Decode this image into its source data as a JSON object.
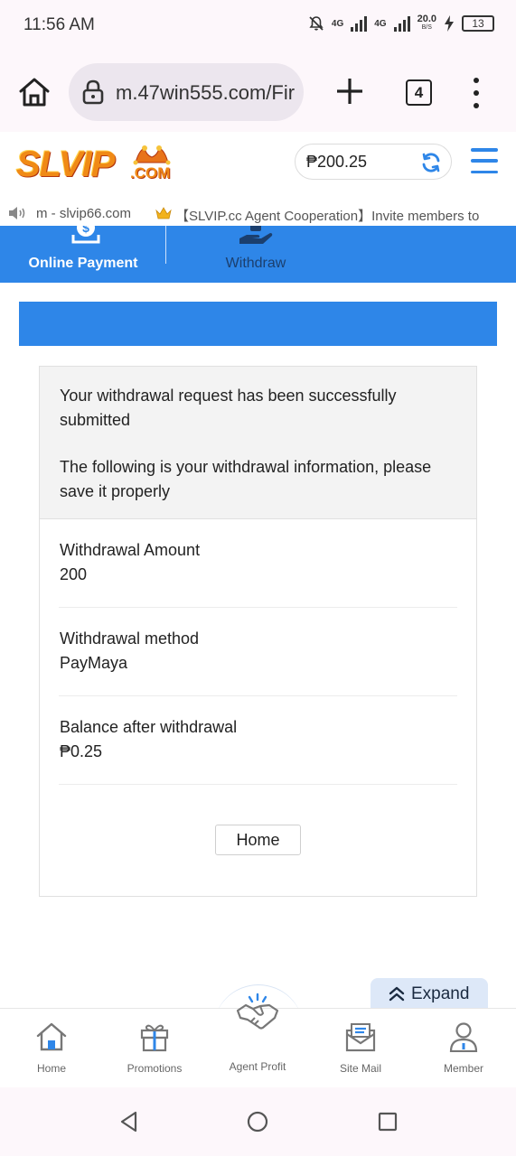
{
  "status_bar": {
    "time": "11:56 AM",
    "net1": "4G",
    "net2": "4G",
    "speed_value": "20.0",
    "speed_unit": "B/S",
    "battery": "13"
  },
  "browser": {
    "url": "m.47win555.com/Fir",
    "tab_count": "4"
  },
  "header": {
    "logo_text": "SLVIP",
    "logo_suffix": ".COM",
    "balance": "₱200.25"
  },
  "marquee": {
    "site": "m - slvip66.com",
    "message": "【SLVIP.cc Agent Cooperation】Invite members to"
  },
  "tabs": [
    {
      "label": "Online Payment",
      "icon": "deposit-icon",
      "active": true
    },
    {
      "label": "Withdraw",
      "icon": "withdraw-icon",
      "active": false
    }
  ],
  "result": {
    "success_message": "Your withdrawal request has been successfully submitted",
    "info_message": "The following is your withdrawal information, please save it properly",
    "rows": [
      {
        "label": "Withdrawal Amount",
        "value": "200"
      },
      {
        "label": "Withdrawal method",
        "value": "PayMaya"
      },
      {
        "label": "Balance after withdrawal",
        "value": "₱0.25"
      }
    ],
    "home_button": "Home"
  },
  "expand": {
    "label": "Expand"
  },
  "bottom_nav": [
    {
      "label": "Home",
      "icon": "home-icon"
    },
    {
      "label": "Promotions",
      "icon": "gift-icon"
    },
    {
      "label": "Agent Profit",
      "icon": "handshake-icon"
    },
    {
      "label": "Site Mail",
      "icon": "mail-icon"
    },
    {
      "label": "Member",
      "icon": "user-icon"
    }
  ],
  "colors": {
    "accent_blue": "#2e86e8",
    "logo_orange": "#f08a16",
    "nav_icon_blue": "#2e86e8"
  }
}
